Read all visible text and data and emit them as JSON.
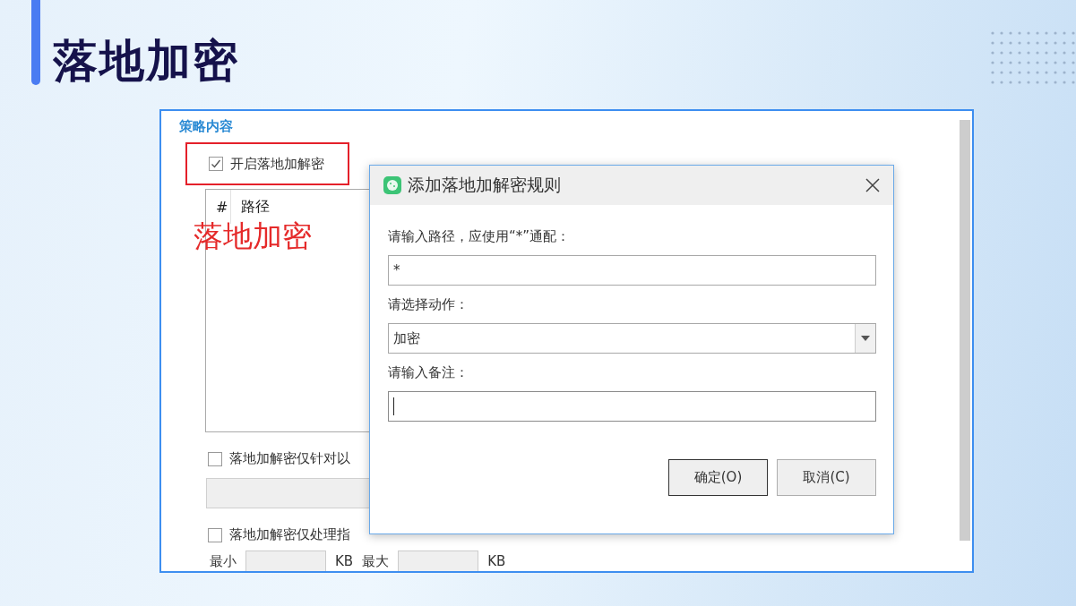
{
  "slide": {
    "title": "落地加密"
  },
  "window": {
    "section_title": "策略内容",
    "enable_option": {
      "label": "开启落地加解密",
      "checked": true,
      "highlighted": true
    },
    "list": {
      "columns": [
        "#",
        "路径"
      ]
    },
    "options": [
      {
        "kind": "checkbox",
        "label": "落地加解密仅针对以",
        "checked": false
      },
      {
        "kind": "bar"
      },
      {
        "kind": "checkbox",
        "label": "落地加解密仅处理指",
        "checked": false
      },
      {
        "kind": "size",
        "items": [
          {
            "label": "最小",
            "unit": "KB"
          },
          {
            "label": "最大",
            "unit": "KB"
          }
        ]
      }
    ]
  },
  "annotation": {
    "text": "落地加密"
  },
  "dialog": {
    "title": "添加落地加解密规则",
    "fields": [
      {
        "kind": "text",
        "label": "请输入路径，应使用“*”通配：",
        "value": "*",
        "focused": false
      },
      {
        "kind": "select",
        "label": "请选择动作：",
        "value": "加密",
        "focused": false
      },
      {
        "kind": "text",
        "label": "请输入备注：",
        "focused": true
      }
    ],
    "buttons": [
      {
        "label": "确定(O)",
        "default": true
      },
      {
        "label": "取消(C)",
        "default": false
      }
    ]
  }
}
